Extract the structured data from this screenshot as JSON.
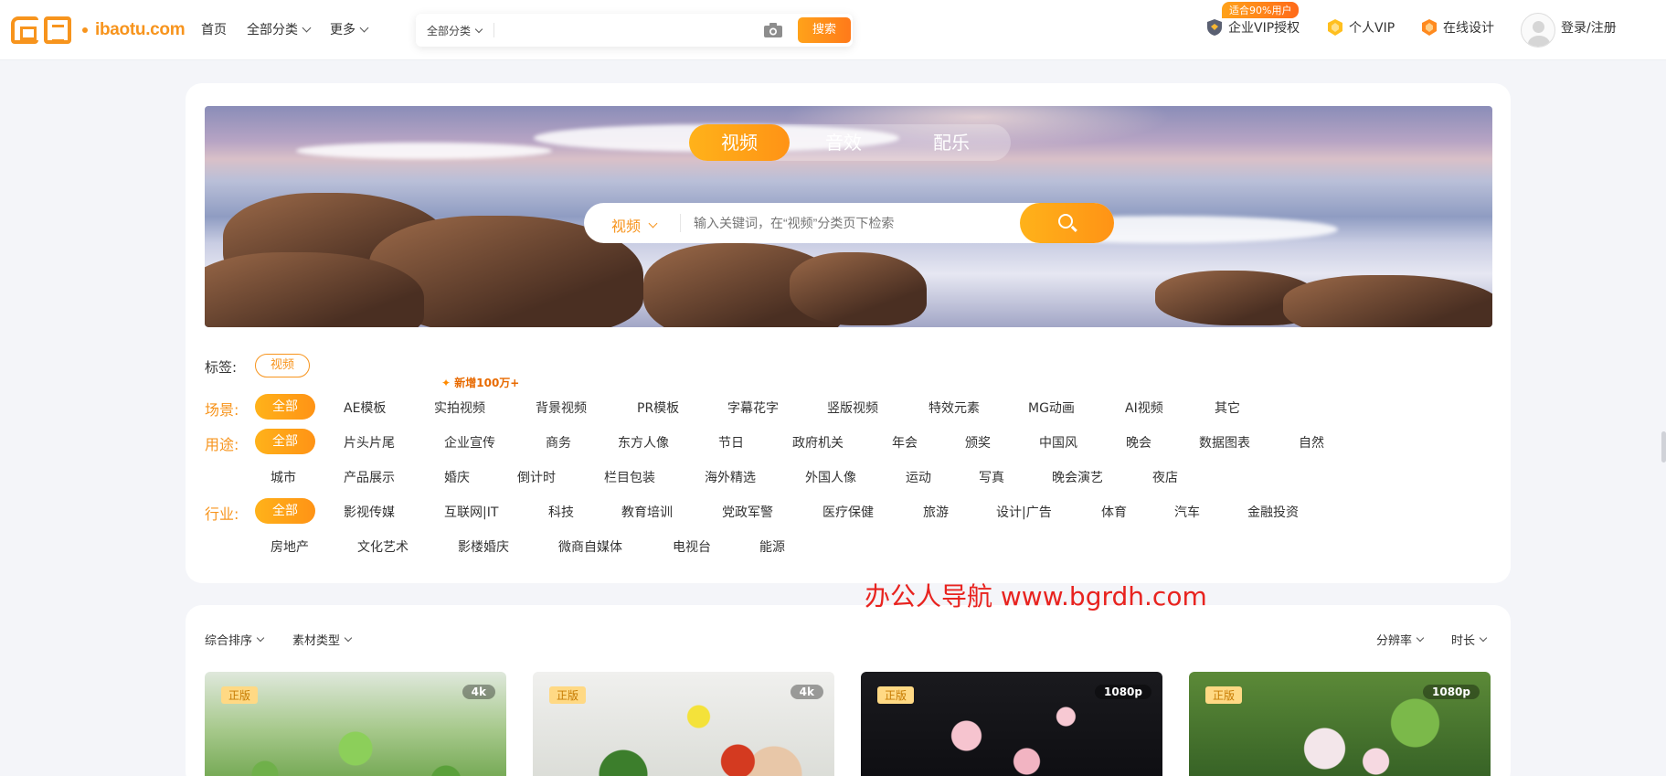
{
  "brand": {
    "domain": "ibaotu.com",
    "accent": "#f7941d"
  },
  "nav": {
    "home": "首页",
    "all_categories": "全部分类",
    "more": "更多"
  },
  "top_search": {
    "category": "全部分类",
    "placeholder": "",
    "button": "搜索"
  },
  "right_nav": {
    "badge": "适合90%用户",
    "enterprise_vip": "企业VIP授权",
    "personal_vip": "个人VIP",
    "online_design": "在线设计",
    "login": "登录/注册"
  },
  "banner": {
    "tabs": [
      "视频",
      "音效",
      "配乐"
    ],
    "active_tab": "视频",
    "search_category": "视频",
    "search_placeholder": "输入关键词，在“视频”分类页下检索"
  },
  "tags": {
    "label": "标签:",
    "selected": "视频"
  },
  "new_tag": "新增100万+",
  "filters": {
    "scene": {
      "label": "场景:",
      "all": "全部",
      "options": [
        "AE模板",
        "实拍视频",
        "背景视频",
        "PR模板",
        "字幕花字",
        "竖版视频",
        "特效元素",
        "MG动画",
        "AI视频",
        "其它"
      ]
    },
    "usage": {
      "label": "用途:",
      "all": "全部",
      "row1": [
        "片头片尾",
        "企业宣传",
        "商务",
        "东方人像",
        "节日",
        "政府机关",
        "年会",
        "颁奖",
        "中国风",
        "晚会",
        "数据图表",
        "自然"
      ],
      "row2": [
        "城市",
        "产品展示",
        "婚庆",
        "倒计时",
        "栏目包装",
        "海外精选",
        "外国人像",
        "运动",
        "写真",
        "晚会演艺",
        "夜店"
      ]
    },
    "industry": {
      "label": "行业:",
      "all": "全部",
      "row1": [
        "影视传媒",
        "互联网|IT",
        "科技",
        "教育培训",
        "党政军警",
        "医疗保健",
        "旅游",
        "设计|广告",
        "体育",
        "汽车",
        "金融投资"
      ],
      "row2": [
        "房地产",
        "文化艺术",
        "影楼婚庆",
        "微商自媒体",
        "电视台",
        "能源"
      ]
    }
  },
  "sort_bar": {
    "sort": "综合排序",
    "type": "素材类型",
    "resolution": "分辨率",
    "duration": "时长"
  },
  "results": [
    {
      "license": "正版",
      "resolution": "4k"
    },
    {
      "license": "正版",
      "resolution": "4k"
    },
    {
      "license": "正版",
      "resolution": "1080p"
    },
    {
      "license": "正版",
      "resolution": "1080p"
    }
  ],
  "watermark": "办公人导航  www.bgrdh.com"
}
